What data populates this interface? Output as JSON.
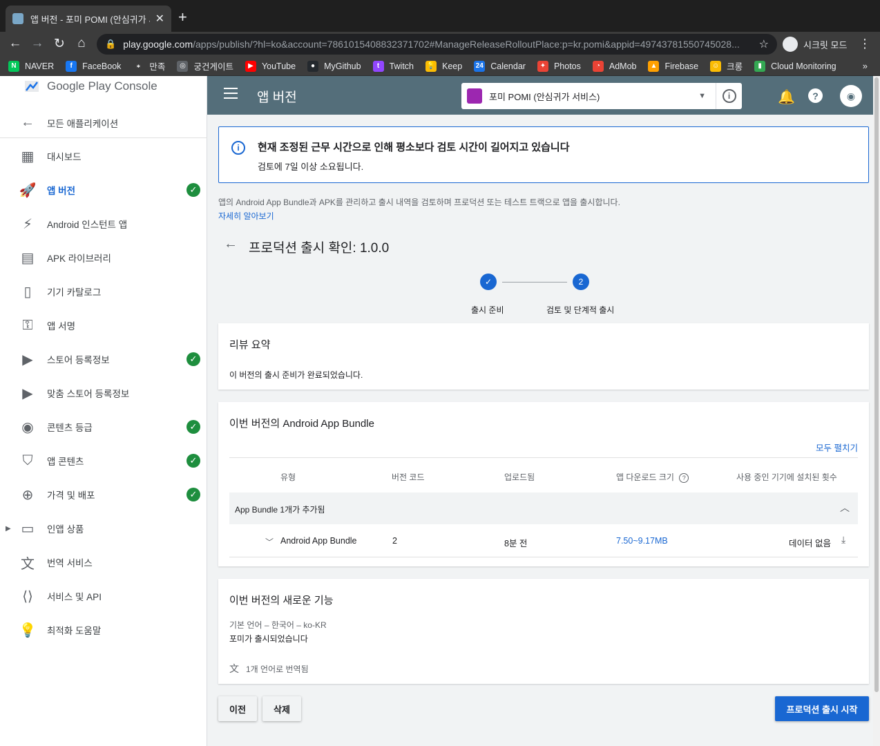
{
  "browser": {
    "tab_title": "앱 버전 - 포미 POMI (안심귀가 서비스",
    "url_host": "play.google.com",
    "url_rest": "/apps/publish/?hl=ko&account=7861015408832371702#ManageReleaseRolloutPlace:p=kr.pomi&appid=49743781550745028...",
    "incognito_label": "시크릿 모드",
    "bookmarks": [
      {
        "label": "NAVER",
        "icon": "naver-icon",
        "color": "#03c75a",
        "glyph": "N"
      },
      {
        "label": "FaceBook",
        "icon": "facebook-icon",
        "color": "#1877f2",
        "glyph": "f"
      },
      {
        "label": "만족",
        "icon": "manjok-icon",
        "color": "#3c3c3c",
        "glyph": "⁎"
      },
      {
        "label": "궁건게이트",
        "icon": "gate-icon",
        "color": "#5f6368",
        "glyph": "◎"
      },
      {
        "label": "YouTube",
        "icon": "youtube-icon",
        "color": "#ff0000",
        "glyph": "▶"
      },
      {
        "label": "MyGithub",
        "icon": "github-icon",
        "color": "#24292e",
        "glyph": "●"
      },
      {
        "label": "Twitch",
        "icon": "twitch-icon",
        "color": "#9146ff",
        "glyph": "t"
      },
      {
        "label": "Keep",
        "icon": "keep-icon",
        "color": "#fbbc04",
        "glyph": "💡"
      },
      {
        "label": "Calendar",
        "icon": "calendar-icon",
        "color": "#1a73e8",
        "glyph": "24"
      },
      {
        "label": "Photos",
        "icon": "photos-icon",
        "color": "#ea4335",
        "glyph": "✦"
      },
      {
        "label": "AdMob",
        "icon": "admob-icon",
        "color": "#ea4335",
        "glyph": "◔"
      },
      {
        "label": "Firebase",
        "icon": "firebase-icon",
        "color": "#ffa000",
        "glyph": "▲"
      },
      {
        "label": "크롱",
        "icon": "crong-icon",
        "color": "#fbbc04",
        "glyph": "☺"
      },
      {
        "label": "Cloud Monitoring",
        "icon": "monitoring-icon",
        "color": "#34a853",
        "glyph": "▮"
      }
    ]
  },
  "sidebar": {
    "brand": "Google Play Console",
    "back_label": "모든 애플리케이션",
    "items": [
      {
        "label": "대시보드",
        "icon": "dashboard-icon",
        "glyph": "▦",
        "check": false,
        "active": false
      },
      {
        "label": "앱 버전",
        "icon": "rocket-icon",
        "glyph": "🚀",
        "check": true,
        "active": true
      },
      {
        "label": "Android 인스턴트 앱",
        "icon": "bolt-icon",
        "glyph": "⚡",
        "check": false,
        "active": false
      },
      {
        "label": "APK 라이브러리",
        "icon": "library-icon",
        "glyph": "▤",
        "check": false,
        "active": false
      },
      {
        "label": "기기 카탈로그",
        "icon": "device-catalog-icon",
        "glyph": "▯",
        "check": false,
        "active": false
      },
      {
        "label": "앱 서명",
        "icon": "key-icon",
        "glyph": "⚿",
        "check": false,
        "active": false
      },
      {
        "label": "스토어 등록정보",
        "icon": "store-listing-icon",
        "glyph": "▶",
        "check": true,
        "active": false
      },
      {
        "label": "맞춤 스토어 등록정보",
        "icon": "custom-listing-icon",
        "glyph": "▶",
        "check": false,
        "active": false
      },
      {
        "label": "콘텐츠 등급",
        "icon": "content-rating-icon",
        "glyph": "◉",
        "check": true,
        "active": false
      },
      {
        "label": "앱 콘텐츠",
        "icon": "shield-icon",
        "glyph": "⛉",
        "check": true,
        "active": false
      },
      {
        "label": "가격 및 배포",
        "icon": "globe-icon",
        "glyph": "⊕",
        "check": true,
        "active": false
      },
      {
        "label": "인앱 상품",
        "icon": "credit-card-icon",
        "glyph": "▭",
        "check": false,
        "active": false,
        "caret": true
      },
      {
        "label": "번역 서비스",
        "icon": "translate-icon",
        "glyph": "文",
        "check": false,
        "active": false
      },
      {
        "label": "서비스 및 API",
        "icon": "api-icon",
        "glyph": "⟨⟩",
        "check": false,
        "active": false
      },
      {
        "label": "최적화 도움말",
        "icon": "lightbulb-icon",
        "glyph": "💡",
        "check": false,
        "active": false
      }
    ]
  },
  "appbar": {
    "title": "앱 버전",
    "app_name": "포미 POMI (안심귀가 서비스)"
  },
  "banner": {
    "title": "현재 조정된 근무 시간으로 인해 평소보다 검토 시간이 길어지고 있습니다",
    "body": "검토에 7일 이상 소요됩니다."
  },
  "description": "앱의 Android App Bundle과 APK를 관리하고 출시 내역을 검토하며 프로덕션 또는 테스트 트랙으로 앱을 출시합니다.",
  "learn_more": "자세히 알아보기",
  "page_title": "프로덕션 출시 확인: 1.0.0",
  "stepper": {
    "step1_label": "출시 준비",
    "step2_number": "2",
    "step2_label": "검토 및 단계적 출시"
  },
  "review": {
    "title": "리뷰 요약",
    "text": "이 버전의 출시 준비가 완료되었습니다."
  },
  "bundle": {
    "title": "이번 버전의 Android App Bundle",
    "expand_all": "모두 펼치기",
    "columns": [
      "유형",
      "버전 코드",
      "업로드됨",
      "앱 다운로드 크기",
      "사용 중인 기기에 설치된 횟수"
    ],
    "group_label": "App Bundle 1개가 추가됨",
    "row": {
      "type": "Android App Bundle",
      "version_code": "2",
      "uploaded": "8분 전",
      "download_size": "7.50~9.17MB",
      "installs": "데이터 없음"
    }
  },
  "whats_new": {
    "title": "이번 버전의 새로운 기능",
    "language": "기본 언어 – 한국어 – ko-KR",
    "text": "포미가 출시되었습니다",
    "translated": "1개 언어로 번역됨"
  },
  "buttons": {
    "prev": "이전",
    "delete": "삭제",
    "start": "프로덕션 출시 시작"
  },
  "colors": {
    "appbar": "#546e7a",
    "accent": "#1967d2",
    "check": "#1e8e3e"
  }
}
